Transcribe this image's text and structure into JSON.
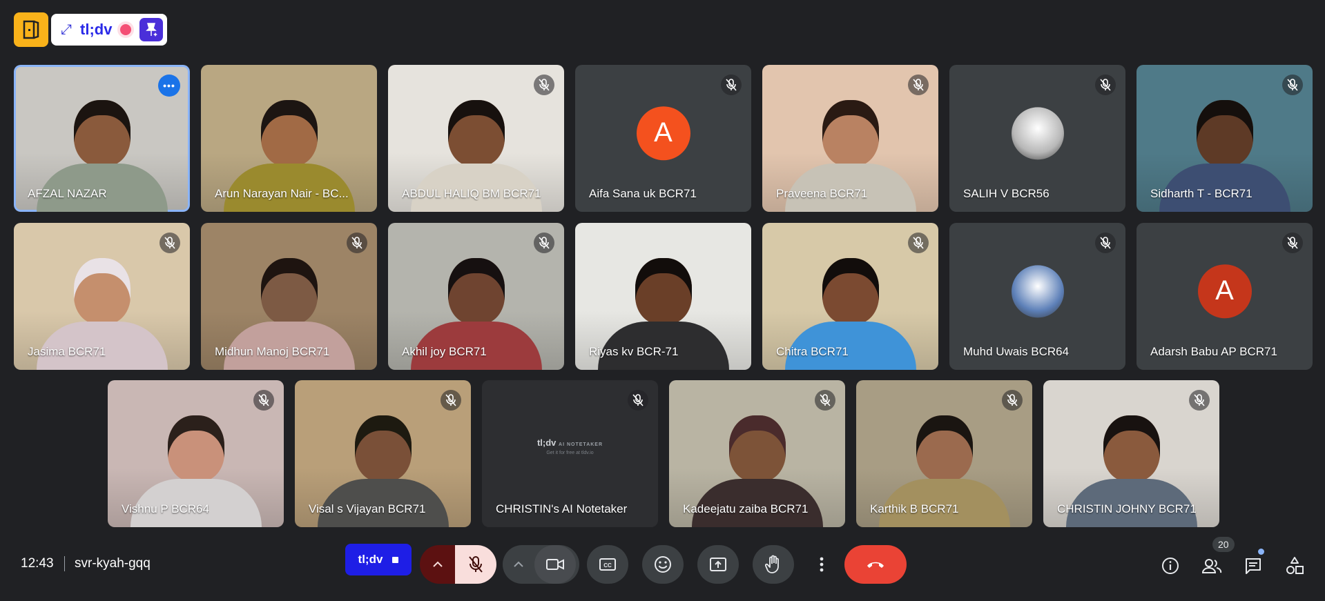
{
  "extension": {
    "brand": "tl;dv"
  },
  "participants": [
    {
      "name": "AFZAL NAZAR",
      "type": "video",
      "muted": false,
      "active": true,
      "bg": "#c9c7c2",
      "skin": "#8a5a3c",
      "hair": "#1b1410",
      "shirt": "#8e9a8a"
    },
    {
      "name": "Arun Narayan Nair - BC...",
      "type": "video",
      "muted": false,
      "bg": "#b9a782",
      "skin": "#a16a45",
      "hair": "#1c1512",
      "shirt": "#9a8a2e"
    },
    {
      "name": "ABDUL HALIQ BM BCR71",
      "type": "video",
      "muted": true,
      "bg": "#e6e3dd",
      "skin": "#7c4e33",
      "hair": "#17110e",
      "shirt": "#d8d2c6"
    },
    {
      "name": "Aifa Sana uk BCR71",
      "type": "letter",
      "letter": "A",
      "letter_bg": "#f4511e",
      "muted": true
    },
    {
      "name": "Praveena BCR71",
      "type": "video",
      "muted": true,
      "bg": "#e2c5ae",
      "skin": "#b98262",
      "hair": "#2a1a13",
      "shirt": "#c7c2b6"
    },
    {
      "name": "SALIH V BCR56",
      "type": "photo",
      "photo_bg": "#b7b7b7",
      "muted": true
    },
    {
      "name": "Sidharth T - BCR71",
      "type": "video",
      "muted": true,
      "bg": "#4f7a88",
      "skin": "#5e3a26",
      "hair": "#150f0c",
      "shirt": "#3d4e72"
    },
    {
      "name": "Jasima BCR71",
      "type": "video",
      "muted": true,
      "bg": "#d9c8aa",
      "skin": "#c58f6d",
      "hair": "#e9e2e6",
      "shirt": "#d4c4c9"
    },
    {
      "name": "Midhun Manoj BCR71",
      "type": "video",
      "muted": true,
      "bg": "#9d8466",
      "skin": "#7d5a44",
      "hair": "#1e1410",
      "shirt": "#c2a09c"
    },
    {
      "name": "Akhil joy BCR71",
      "type": "video",
      "muted": true,
      "bg": "#b4b4ad",
      "skin": "#6f4430",
      "hair": "#161010",
      "shirt": "#9c3b3d"
    },
    {
      "name": "Riyas kv BCR-71",
      "type": "video",
      "muted": false,
      "bg": "#e7e7e3",
      "skin": "#6a3f28",
      "hair": "#120d0b",
      "shirt": "#2d2d2f"
    },
    {
      "name": "Chitra BCR71",
      "type": "video",
      "muted": true,
      "bg": "#d7c9a8",
      "skin": "#7b4a31",
      "hair": "#120d0b",
      "shirt": "#3f93d8"
    },
    {
      "name": "Muhd Uwais BCR64",
      "type": "photo",
      "photo_bg": "#5d80b8",
      "muted": true
    },
    {
      "name": "Adarsh Babu AP BCR71",
      "type": "letter",
      "letter": "A",
      "letter_bg": "#c5361b",
      "muted": true
    },
    {
      "name": "Vishnu P BCR64",
      "type": "video",
      "muted": true,
      "bg": "#c9b7b4",
      "skin": "#c9917a",
      "hair": "#2b201b",
      "shirt": "#d3d0d0"
    },
    {
      "name": "Visal s Vijayan BCR71",
      "type": "video",
      "muted": true,
      "bg": "#b99f79",
      "skin": "#7a5038",
      "hair": "#1d1a10",
      "shirt": "#4e4e4c"
    },
    {
      "name": "CHRISTIN's AI Notetaker",
      "type": "notetaker",
      "muted": true,
      "nt_brand": "tl;dv",
      "nt_tag": "AI NOTETAKER",
      "nt_sub": "Get it for free at tldv.io"
    },
    {
      "name": "Kadeejatu zaiba BCR71",
      "type": "video",
      "muted": true,
      "bg": "#b9b4a3",
      "skin": "#7d5338",
      "hair": "#4a2b2c",
      "shirt": "#3a2d2d"
    },
    {
      "name": "Karthik B BCR71",
      "type": "video",
      "muted": true,
      "bg": "#a89d84",
      "skin": "#9b6a4e",
      "hair": "#1a1511",
      "shirt": "#a3905f"
    },
    {
      "name": "CHRISTIN JOHNY BCR71",
      "type": "video",
      "muted": true,
      "bg": "#d9d5cf",
      "skin": "#8a5a3d",
      "hair": "#181210",
      "shirt": "#5d6a7a"
    }
  ],
  "meeting": {
    "time": "12:43",
    "code": "svr-kyah-gqq"
  },
  "controls": {
    "tldv_label": "tl;dv"
  },
  "people_count": "20",
  "colors": {
    "end_call": "#ea4335",
    "mic_off_bg": "#f9dedc",
    "accent": "#8ab4f8"
  }
}
